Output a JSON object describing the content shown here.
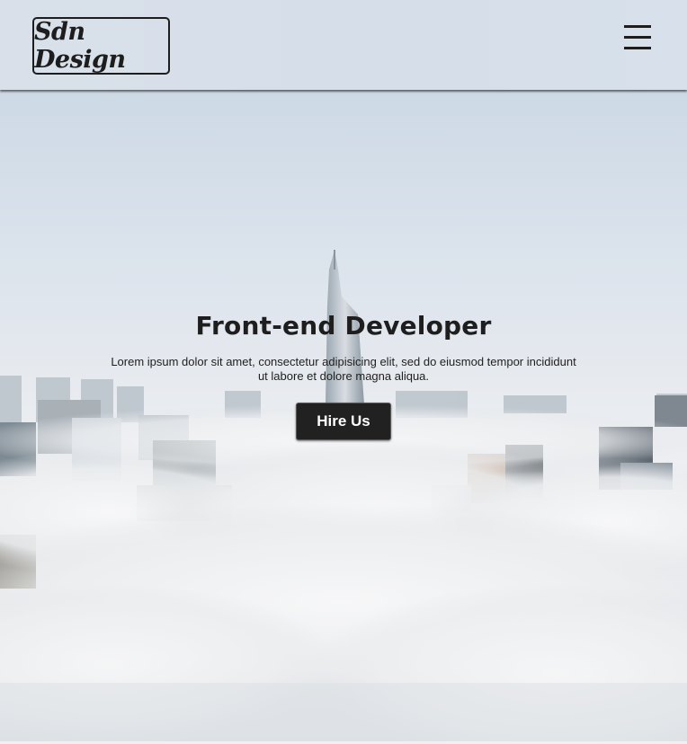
{
  "header": {
    "logo_text": "Sdn Design",
    "menu_icon": "hamburger-menu-icon"
  },
  "hero": {
    "title": "Front-end Developer",
    "text": "Lorem ipsum dolor sit amet, consectetur adipisicing elit, sed do eiusmod tempor incididunt ut labore et dolore magna aliqua.",
    "button_label": "Hire Us",
    "background": "city skyline above clouds"
  },
  "colors": {
    "header_bg": "#d8e0ea",
    "text": "#1e1e1e",
    "button_bg": "#212121",
    "button_text": "#ffffff"
  }
}
